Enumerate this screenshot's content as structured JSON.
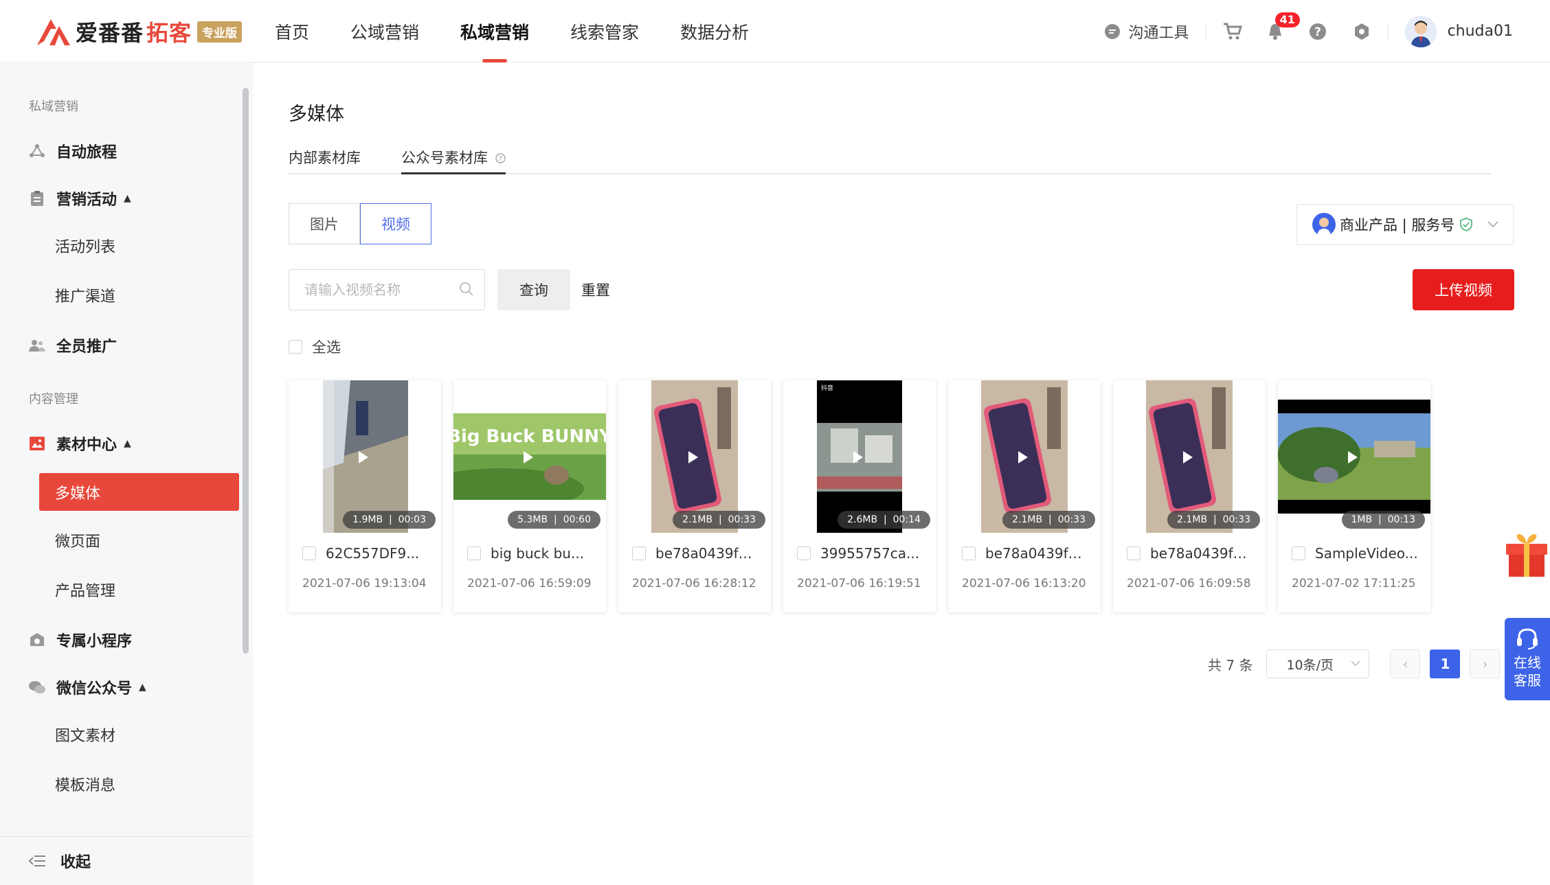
{
  "header": {
    "logo_main": "爱番番",
    "logo_sub": "拓客",
    "logo_badge": "专业版",
    "nav": [
      {
        "label": "首页"
      },
      {
        "label": "公域营销"
      },
      {
        "label": "私域营销"
      },
      {
        "label": "线索管家"
      },
      {
        "label": "数据分析"
      }
    ],
    "tool_label": "沟通工具",
    "notification_count": "41",
    "username": "chuda01"
  },
  "sidebar": {
    "group1": "私域营销",
    "auto_journey": "自动旅程",
    "marketing_activity": "营销活动",
    "activity_list": "活动列表",
    "promo_channel": "推广渠道",
    "all_staff": "全员推广",
    "group2": "内容管理",
    "material_center": "素材中心",
    "multimedia": "多媒体",
    "micro_page": "微页面",
    "product_mgmt": "产品管理",
    "mini_program": "专属小程序",
    "wechat_official": "微信公众号",
    "article_material": "图文素材",
    "template_msg": "模板消息",
    "collapse": "收起"
  },
  "main": {
    "title": "多媒体",
    "tabs": [
      {
        "label": "内部素材库"
      },
      {
        "label": "公众号素材库"
      }
    ],
    "seg": [
      {
        "label": "图片"
      },
      {
        "label": "视频"
      }
    ],
    "account_label": "商业产品 | 服务号",
    "search_placeholder": "请输入视频名称",
    "query_label": "查询",
    "reset_label": "重置",
    "upload_label": "上传视频",
    "select_all": "全选",
    "cards": [
      {
        "name": "62C557DF9...",
        "size": "1.9MB",
        "duration": "00:03",
        "date": "2021-07-06 19:13:04"
      },
      {
        "name": "big buck bu...",
        "size": "5.3MB",
        "duration": "00:60",
        "date": "2021-07-06 16:59:09"
      },
      {
        "name": "be78a0439fc...",
        "size": "2.1MB",
        "duration": "00:33",
        "date": "2021-07-06 16:28:12"
      },
      {
        "name": "39955757ca...",
        "size": "2.6MB",
        "duration": "00:14",
        "date": "2021-07-06 16:19:51"
      },
      {
        "name": "be78a0439fc...",
        "size": "2.1MB",
        "duration": "00:33",
        "date": "2021-07-06 16:13:20"
      },
      {
        "name": "be78a0439fc...",
        "size": "2.1MB",
        "duration": "00:33",
        "date": "2021-07-06 16:09:58"
      },
      {
        "name": "SampleVideo...",
        "size": "1MB",
        "duration": "00:13",
        "date": "2021-07-02 17:11:25"
      }
    ],
    "thumb_text": {
      "bunny": "Big Buck BUNNY",
      "tiktok": "抖音"
    },
    "pager": {
      "total": "共 7 条",
      "page_size": "10条/页",
      "current": "1",
      "prev": "‹",
      "next": "›"
    },
    "service_label": "在线客服"
  },
  "colors": {
    "brand_red": "#e8483b",
    "upload_red": "#e71d1d",
    "accent_blue": "#3d63e8"
  }
}
